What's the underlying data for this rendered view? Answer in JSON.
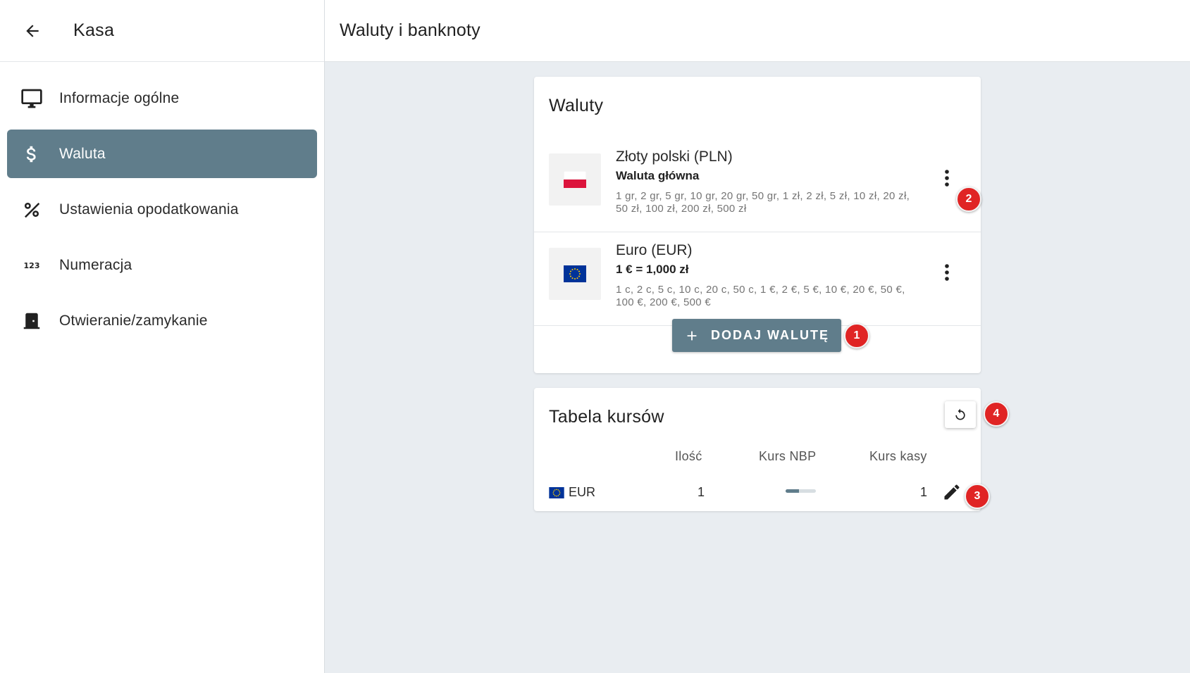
{
  "sidebar": {
    "title": "Kasa",
    "items": [
      {
        "label": "Informacje ogólne",
        "icon": "monitor-icon",
        "active": false
      },
      {
        "label": "Waluta",
        "icon": "dollar-icon",
        "active": true
      },
      {
        "label": "Ustawienia opodatkowania",
        "icon": "percent-icon",
        "active": false
      },
      {
        "label": "Numeracja",
        "icon": "numbers-123-icon",
        "active": false
      },
      {
        "label": "Otwieranie/zamykanie",
        "icon": "door-icon",
        "active": false
      }
    ]
  },
  "topbar": {
    "title": "Waluty i banknoty"
  },
  "currencies": {
    "title": "Waluty",
    "items": [
      {
        "name": "Złoty polski (PLN)",
        "subtitle": "Waluta główna",
        "denominations": "1 gr, 2 gr, 5 gr, 10 gr, 20 gr, 50 gr, 1 zł, 2 zł, 5 zł, 10 zł, 20 zł, 50 zł, 100 zł, 200 zł, 500 zł",
        "flag": "poland-flag-icon"
      },
      {
        "name": "Euro (EUR)",
        "subtitle": "1 € = 1,000 zł",
        "denominations": "1 c, 2 c, 5 c, 10 c, 20 c, 50 c, 1 €, 2 €, 5 €, 10 €, 20 €, 50 €, 100 €, 200 €, 500 €",
        "flag": "eu-flag-icon"
      }
    ],
    "add_button_label": "DODAJ WALUTĘ"
  },
  "rates": {
    "title": "Tabela kursów",
    "columns": [
      "Ilość",
      "Kurs NBP",
      "Kurs kasy"
    ],
    "rows": [
      {
        "currency": "EUR",
        "quantity": "1",
        "nbp_loading_fraction": 0.45,
        "cash_rate": "1"
      }
    ]
  },
  "badges": [
    "1",
    "2",
    "3",
    "4"
  ],
  "colors": {
    "accent": "#607d8b",
    "badge": "#e02424",
    "background": "#e9edf1"
  }
}
